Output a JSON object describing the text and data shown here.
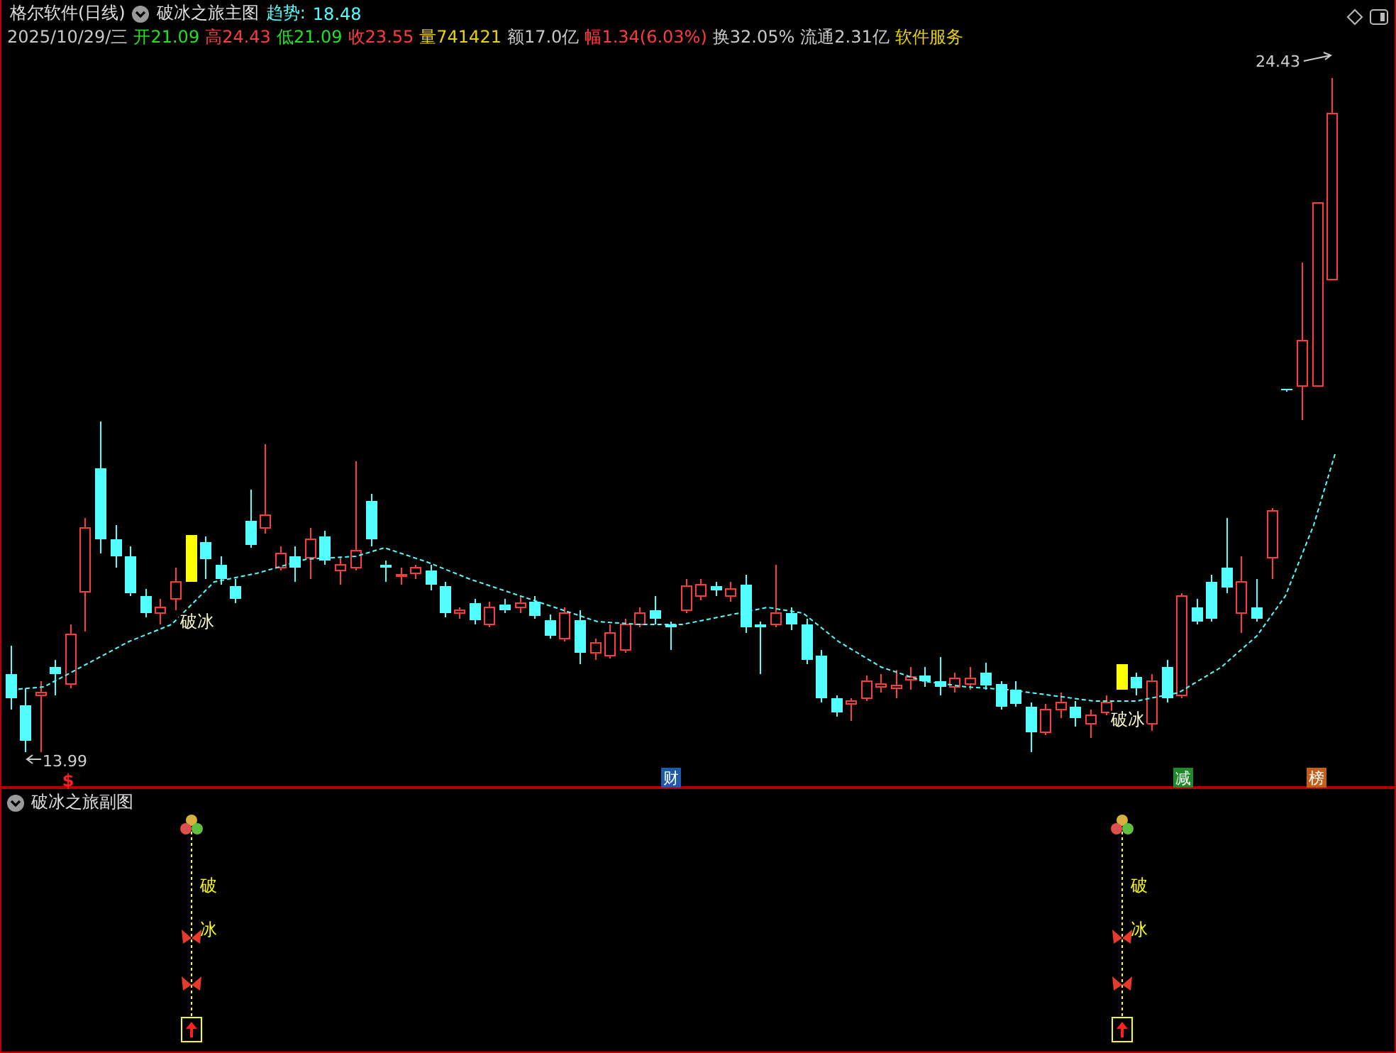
{
  "main_chart": {
    "title": "格尔软件(日线)",
    "indicator": "破冰之旅主图",
    "trend": {
      "label": "趋势:",
      "value": "18.48"
    },
    "quote": [
      {
        "text": "2025/10/29/三",
        "color": "#c8c8c8"
      },
      {
        "text": "开21.09",
        "color": "#22e022"
      },
      {
        "text": "高24.43",
        "color": "#ff3c3c"
      },
      {
        "text": "低21.09",
        "color": "#22e022"
      },
      {
        "text": "收23.55",
        "color": "#ff3c3c"
      },
      {
        "text": "量741421",
        "color": "#e8d200"
      },
      {
        "text": "额17.0亿",
        "color": "#c8c8c8"
      },
      {
        "text": "幅1.34(6.03%)",
        "color": "#ff3c3c"
      },
      {
        "text": "换32.05%",
        "color": "#c8c8c8"
      },
      {
        "text": "流通2.31亿",
        "color": "#c8c8c8"
      },
      {
        "text": "软件服务",
        "color": "#e8d200"
      }
    ],
    "high_label": "24.43",
    "low_label": "13.99",
    "signals": [
      "破冰",
      "破冰"
    ],
    "markers": [
      {
        "text": "$",
        "kind": "text",
        "color": "#ff2020"
      },
      {
        "text": "财",
        "kind": "badge",
        "color": "#1e5aa8"
      },
      {
        "text": "减",
        "kind": "badge",
        "color": "#1f8a2a"
      },
      {
        "text": "榜",
        "kind": "badge",
        "color": "#c0601a"
      }
    ]
  },
  "sub_chart": {
    "title": "破冰之旅副图",
    "signals": [
      {
        "chars": [
          "破",
          "冰"
        ]
      },
      {
        "chars": [
          "破",
          "冰"
        ]
      }
    ]
  }
}
